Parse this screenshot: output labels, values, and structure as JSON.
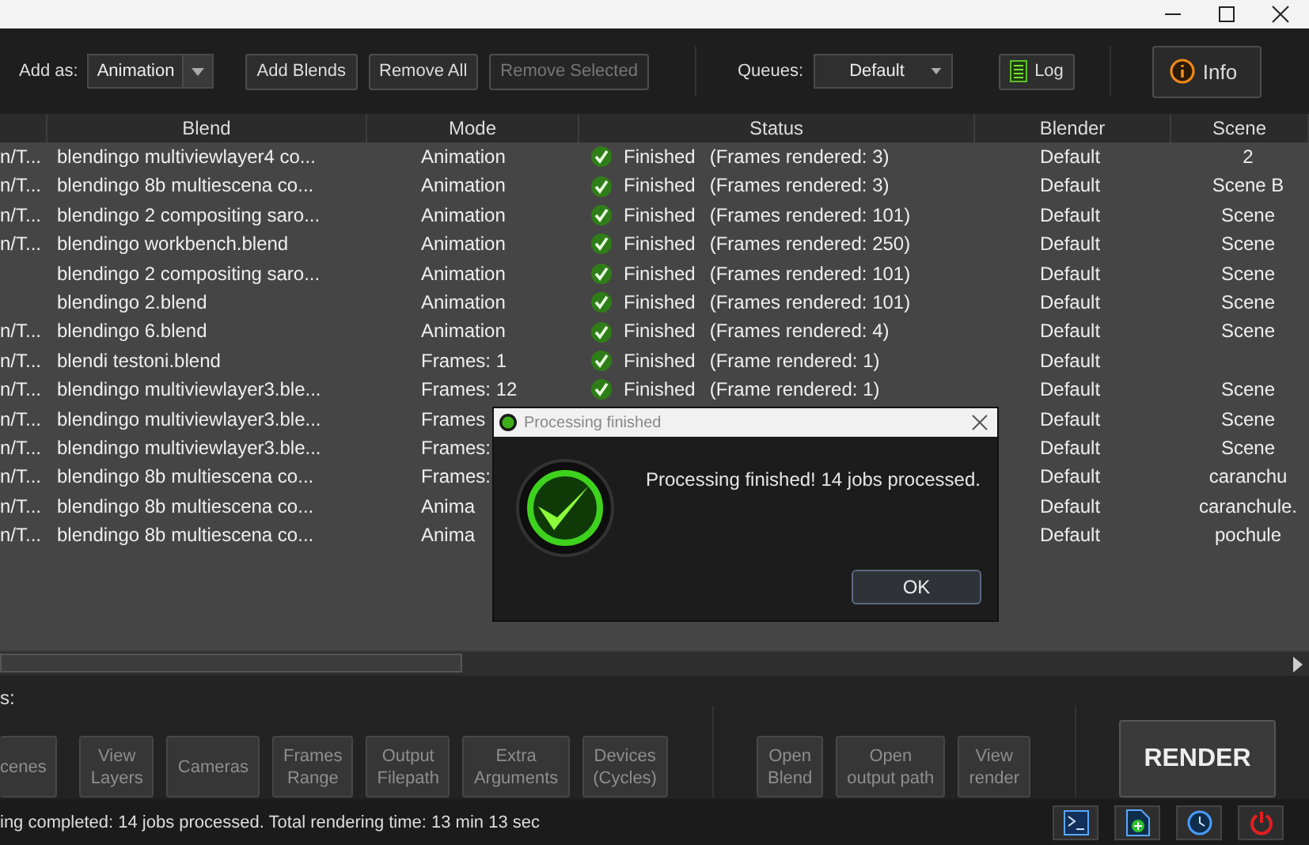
{
  "toolbar": {
    "add_as_label": "Add as:",
    "add_as_value": "Animation",
    "buttons": [
      {
        "label": "Add Blends",
        "disabled": false
      },
      {
        "label": "Remove All",
        "disabled": false
      },
      {
        "label": "Remove Selected",
        "disabled": true
      }
    ],
    "queues_label": "Queues:",
    "queues_value": "Default",
    "log_button": "Log",
    "info_button": "Info"
  },
  "table": {
    "columns": [
      "",
      "Blend",
      "Mode",
      "Status",
      "Blender",
      "Scene"
    ],
    "rows": [
      {
        "column_1": "n/T...",
        "blend": "blendingo multiviewlayer4 co...",
        "mode": "Animation",
        "finished": true,
        "status": "Finished",
        "detail": "(Frames rendered: 3)",
        "blender": "Default",
        "scene": "2"
      },
      {
        "column_1": "n/T...",
        "blend": "blendingo 8b multiescena co...",
        "mode": "Animation",
        "finished": true,
        "status": "Finished",
        "detail": "(Frames rendered: 3)",
        "blender": "Default",
        "scene": "Scene B"
      },
      {
        "column_1": "n/T...",
        "blend": "blendingo 2 compositing saro...",
        "mode": "Animation",
        "finished": true,
        "status": "Finished",
        "detail": "(Frames rendered: 101)",
        "blender": "Default",
        "scene": "Scene"
      },
      {
        "column_1": "n/T...",
        "blend": "blendingo workbench.blend",
        "mode": "Animation",
        "finished": true,
        "status": "Finished",
        "detail": "(Frames rendered: 250)",
        "blender": "Default",
        "scene": "Scene"
      },
      {
        "blend": "blendingo 2 compositing saro...",
        "mode": "Animation",
        "finished": true,
        "status": "Finished",
        "detail": "(Frames rendered: 101)",
        "blender": "Default",
        "scene": "Scene"
      },
      {
        "blend": "blendingo 2.blend",
        "mode": "Animation",
        "finished": true,
        "status": "Finished",
        "detail": "(Frames rendered: 101)",
        "blender": "Default",
        "scene": "Scene"
      },
      {
        "column_1": "n/T...",
        "blend": "blendingo 6.blend",
        "mode": "Animation",
        "finished": true,
        "status": "Finished",
        "detail": "(Frames rendered: 4)",
        "blender": "Default",
        "scene": "Scene"
      },
      {
        "column_1": "n/T...",
        "blend": "blendi testoni.blend",
        "mode": "Frames: 1",
        "finished": true,
        "status": "Finished",
        "detail": "(Frame rendered: 1)",
        "blender": "Default"
      },
      {
        "column_1": "n/T...",
        "blend": "blendingo multiviewlayer3.ble...",
        "mode": "Frames: 12",
        "finished": true,
        "status": "Finished",
        "detail": "(Frame rendered: 1)",
        "blender": "Default",
        "scene": "Scene"
      },
      {
        "column_1": "n/T...",
        "blend": "blendingo multiviewlayer3.ble...",
        "mode": "Frames",
        "blender": "Default",
        "scene": "Scene"
      },
      {
        "column_1": "n/T...",
        "blend": "blendingo multiviewlayer3.ble...",
        "mode": "Frames:",
        "blender": "Default",
        "scene": "Scene"
      },
      {
        "column_1": "n/T...",
        "blend": "blendingo 8b multiescena co...",
        "mode": "Frames:",
        "blender": "Default",
        "scene": "caranchu"
      },
      {
        "column_1": "n/T...",
        "blend": "blendingo 8b multiescena co...",
        "mode": "Anima",
        "blender": "Default",
        "scene": "caranchule."
      },
      {
        "column_1": "n/T...",
        "blend": "blendingo 8b multiescena co...",
        "mode": "Anima",
        "blender": "Default",
        "scene": "pochule"
      }
    ]
  },
  "options": {
    "label": "s:",
    "buttons": [
      {
        "lines": [
          "cenes"
        ]
      },
      {
        "lines": [
          "View",
          "Layers"
        ]
      },
      {
        "lines": [
          "Cameras"
        ]
      },
      {
        "lines": [
          "Frames",
          "Range"
        ]
      },
      {
        "lines": [
          "Output",
          "Filepath"
        ]
      },
      {
        "lines": [
          "Extra",
          "Arguments"
        ]
      },
      {
        "lines": [
          "Devices",
          "(Cycles)"
        ]
      }
    ],
    "actions": [
      {
        "lines": [
          "Open",
          "Blend"
        ]
      },
      {
        "lines": [
          "Open",
          "output path"
        ]
      },
      {
        "lines": [
          "View",
          "render"
        ]
      }
    ],
    "render_button": "RENDER"
  },
  "status_bar": {
    "text": "ing completed: 14 jobs processed. Total rendering time: 13 min 13 sec"
  },
  "dialog": {
    "title": "Processing finished",
    "message": "Processing finished! 14 jobs processed.",
    "button": "OK"
  }
}
